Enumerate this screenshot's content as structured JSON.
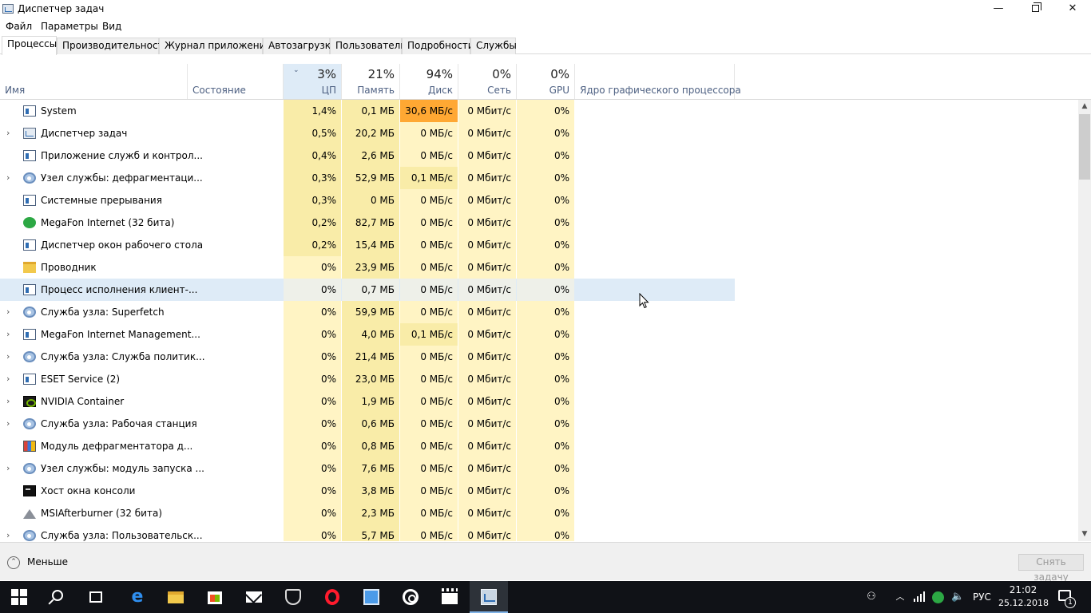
{
  "window": {
    "title": "Диспетчер задач",
    "minimize": "—",
    "close": "✕"
  },
  "menu": [
    "Файл",
    "Параметры",
    "Вид"
  ],
  "tabs": [
    "Процессы",
    "Производительность",
    "Журнал приложений",
    "Автозагрузка",
    "Пользователи",
    "Подробности",
    "Службы"
  ],
  "active_tab": "Процессы",
  "columns": {
    "name": "Имя",
    "status": "Состояние",
    "cpu": {
      "pct": "3%",
      "label": "ЦП"
    },
    "memory": {
      "pct": "21%",
      "label": "Память"
    },
    "disk": {
      "pct": "94%",
      "label": "Диск"
    },
    "network": {
      "pct": "0%",
      "label": "Сеть"
    },
    "gpu": {
      "pct": "0%",
      "label": "GPU"
    },
    "gpu_engine": "Ядро графического процессора",
    "sort_indicator": "⌄"
  },
  "processes": [
    {
      "name": "System",
      "icon": "window-icon",
      "expandable": false,
      "cpu": "1,4%",
      "mem": "0,1 МБ",
      "disk": "30,6 МБ/с",
      "net": "0 Мбит/с",
      "gpu": "0%",
      "cpu_level": 2,
      "disk_level": 3
    },
    {
      "name": "Диспетчер задач",
      "icon": "taskmgr-icon",
      "expandable": true,
      "cpu": "0,5%",
      "mem": "20,2 МБ",
      "disk": "0 МБ/с",
      "net": "0 Мбит/с",
      "gpu": "0%",
      "cpu_level": 2,
      "disk_level": 1
    },
    {
      "name": "Приложение служб и контрол...",
      "icon": "window-icon",
      "expandable": false,
      "cpu": "0,4%",
      "mem": "2,6 МБ",
      "disk": "0 МБ/с",
      "net": "0 Мбит/с",
      "gpu": "0%",
      "cpu_level": 2,
      "disk_level": 1
    },
    {
      "name": "Узел службы: дефрагментаци...",
      "icon": "gear-icon",
      "expandable": true,
      "cpu": "0,3%",
      "mem": "52,9 МБ",
      "disk": "0,1 МБ/с",
      "net": "0 Мбит/с",
      "gpu": "0%",
      "cpu_level": 2,
      "disk_level": 2
    },
    {
      "name": "Системные прерывания",
      "icon": "window-icon",
      "expandable": false,
      "cpu": "0,3%",
      "mem": "0 МБ",
      "disk": "0 МБ/с",
      "net": "0 Мбит/с",
      "gpu": "0%",
      "cpu_level": 2,
      "disk_level": 1
    },
    {
      "name": "MegaFon Internet (32 бита)",
      "icon": "megafon-icon",
      "expandable": false,
      "cpu": "0,2%",
      "mem": "82,7 МБ",
      "disk": "0 МБ/с",
      "net": "0 Мбит/с",
      "gpu": "0%",
      "cpu_level": 2,
      "disk_level": 1
    },
    {
      "name": "Диспетчер окон рабочего стола",
      "icon": "window-icon",
      "expandable": false,
      "cpu": "0,2%",
      "mem": "15,4 МБ",
      "disk": "0 МБ/с",
      "net": "0 Мбит/с",
      "gpu": "0%",
      "cpu_level": 2,
      "disk_level": 1
    },
    {
      "name": "Проводник",
      "icon": "folder-icon",
      "expandable": false,
      "cpu": "0%",
      "mem": "23,9 МБ",
      "disk": "0 МБ/с",
      "net": "0 Мбит/с",
      "gpu": "0%",
      "cpu_level": 1,
      "disk_level": 1
    },
    {
      "name": "Процесс исполнения клиент-...",
      "icon": "window-icon",
      "expandable": false,
      "cpu": "0%",
      "mem": "0,7 МБ",
      "disk": "0 МБ/с",
      "net": "0 Мбит/с",
      "gpu": "0%",
      "cpu_level": 1,
      "disk_level": 1,
      "selected": true
    },
    {
      "name": "Служба узла: Superfetch",
      "icon": "gear-icon",
      "expandable": true,
      "cpu": "0%",
      "mem": "59,9 МБ",
      "disk": "0 МБ/с",
      "net": "0 Мбит/с",
      "gpu": "0%",
      "cpu_level": 1,
      "disk_level": 1
    },
    {
      "name": "MegaFon Internet Management...",
      "icon": "window-icon",
      "expandable": true,
      "cpu": "0%",
      "mem": "4,0 МБ",
      "disk": "0,1 МБ/с",
      "net": "0 Мбит/с",
      "gpu": "0%",
      "cpu_level": 1,
      "disk_level": 2
    },
    {
      "name": "Служба узла: Служба политик...",
      "icon": "gear-icon",
      "expandable": true,
      "cpu": "0%",
      "mem": "21,4 МБ",
      "disk": "0 МБ/с",
      "net": "0 Мбит/с",
      "gpu": "0%",
      "cpu_level": 1,
      "disk_level": 1
    },
    {
      "name": "ESET Service (2)",
      "icon": "window-icon",
      "expandable": true,
      "cpu": "0%",
      "mem": "23,0 МБ",
      "disk": "0 МБ/с",
      "net": "0 Мбит/с",
      "gpu": "0%",
      "cpu_level": 1,
      "disk_level": 1
    },
    {
      "name": "NVIDIA Container",
      "icon": "nvidia-icon",
      "expandable": true,
      "cpu": "0%",
      "mem": "1,9 МБ",
      "disk": "0 МБ/с",
      "net": "0 Мбит/с",
      "gpu": "0%",
      "cpu_level": 1,
      "disk_level": 1
    },
    {
      "name": "Служба узла: Рабочая станция",
      "icon": "gear-icon",
      "expandable": true,
      "cpu": "0%",
      "mem": "0,6 МБ",
      "disk": "0 МБ/с",
      "net": "0 Мбит/с",
      "gpu": "0%",
      "cpu_level": 1,
      "disk_level": 1
    },
    {
      "name": "Модуль дефрагментатора д...",
      "icon": "defrag-icon",
      "expandable": false,
      "cpu": "0%",
      "mem": "0,8 МБ",
      "disk": "0 МБ/с",
      "net": "0 Мбит/с",
      "gpu": "0%",
      "cpu_level": 1,
      "disk_level": 1
    },
    {
      "name": "Узел службы: модуль запуска ...",
      "icon": "gear-icon",
      "expandable": true,
      "cpu": "0%",
      "mem": "7,6 МБ",
      "disk": "0 МБ/с",
      "net": "0 Мбит/с",
      "gpu": "0%",
      "cpu_level": 1,
      "disk_level": 1
    },
    {
      "name": "Хост окна консоли",
      "icon": "console-icon",
      "expandable": false,
      "cpu": "0%",
      "mem": "3,8 МБ",
      "disk": "0 МБ/с",
      "net": "0 Мбит/с",
      "gpu": "0%",
      "cpu_level": 1,
      "disk_level": 1
    },
    {
      "name": "MSIAfterburner (32 бита)",
      "icon": "airplane-icon",
      "expandable": false,
      "cpu": "0%",
      "mem": "2,3 МБ",
      "disk": "0 МБ/с",
      "net": "0 Мбит/с",
      "gpu": "0%",
      "cpu_level": 1,
      "disk_level": 1
    },
    {
      "name": "Служба узла: Пользовательск...",
      "icon": "gear-icon",
      "expandable": true,
      "cpu": "0%",
      "mem": "5,7 МБ",
      "disk": "0 МБ/с",
      "net": "0 Мбит/с",
      "gpu": "0%",
      "cpu_level": 1,
      "disk_level": 1
    }
  ],
  "heat_colors": {
    "level1": "#fff4c4",
    "level2": "#f9eca8",
    "level3": "#ffa833",
    "selected": "#deebf7"
  },
  "footer": {
    "less_label": "Меньше",
    "end_task_label": "Снять задачу"
  },
  "taskbar": {
    "lang": "РУС",
    "time": "21:02",
    "date": "25.12.2018",
    "notifications_count": "1"
  }
}
